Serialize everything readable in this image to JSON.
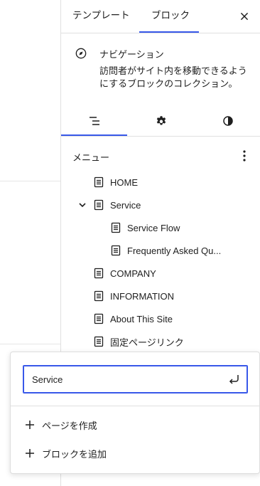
{
  "tabs": {
    "template": "テンプレート",
    "block": "ブロック"
  },
  "block_card": {
    "title": "ナビゲーション",
    "description": "訪問者がサイト内を移動できるようにするブロックのコレクション。"
  },
  "menu": {
    "heading": "メニュー",
    "items": [
      {
        "label": "HOME"
      },
      {
        "label": "Service"
      },
      {
        "label": "Service Flow"
      },
      {
        "label": "Frequently Asked Qu..."
      },
      {
        "label": "COMPANY"
      },
      {
        "label": "INFORMATION"
      },
      {
        "label": "About This Site"
      },
      {
        "label": "固定ページリンク"
      }
    ]
  },
  "link_popover": {
    "input_value": "Service",
    "actions": [
      {
        "label": "ページを作成"
      },
      {
        "label": "ブロックを追加"
      }
    ]
  },
  "colors": {
    "accent": "#3858e9",
    "text": "#1e1e1e",
    "border": "#e0e0e0"
  }
}
